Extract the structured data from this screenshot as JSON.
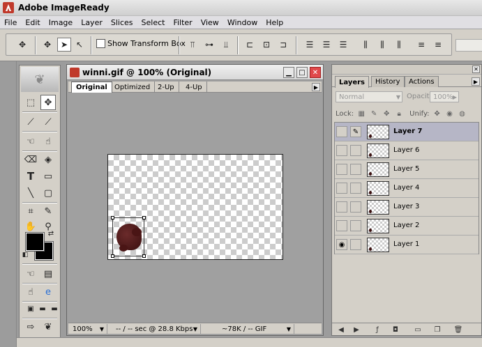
{
  "app": {
    "title": "Adobe ImageReady"
  },
  "menu": [
    "File",
    "Edit",
    "Image",
    "Layer",
    "Slices",
    "Select",
    "Filter",
    "View",
    "Window",
    "Help"
  ],
  "options": {
    "show_transform_box": "Show Transform Box",
    "show_transform_checked": false
  },
  "document": {
    "title": "winni.gif @ 100% (Original)",
    "tabs": [
      "Original",
      "Optimized",
      "2-Up",
      "4-Up"
    ],
    "active_tab": "Original",
    "status": {
      "zoom": "100%",
      "timing": "-- / -- sec @ 28.8 Kbps",
      "size": "~78K / -- GIF"
    }
  },
  "colors": {
    "foreground": "#000000",
    "background": "#000000",
    "selected_layer": "#b6b6c6"
  },
  "layers_palette": {
    "tabs": [
      "Layers",
      "History",
      "Actions"
    ],
    "active_tab": "Layers",
    "blend_mode": "Normal",
    "opacity_label": "Opacity:",
    "opacity": "100%",
    "lock_label": "Lock:",
    "unify_label": "Unify:",
    "layers": [
      {
        "name": "Layer 7",
        "visible": false,
        "selected": true
      },
      {
        "name": "Layer 6",
        "visible": false,
        "selected": false
      },
      {
        "name": "Layer 5",
        "visible": false,
        "selected": false
      },
      {
        "name": "Layer 4",
        "visible": false,
        "selected": false
      },
      {
        "name": "Layer 3",
        "visible": false,
        "selected": false
      },
      {
        "name": "Layer 2",
        "visible": false,
        "selected": false
      },
      {
        "name": "Layer 1",
        "visible": true,
        "selected": false
      }
    ]
  }
}
